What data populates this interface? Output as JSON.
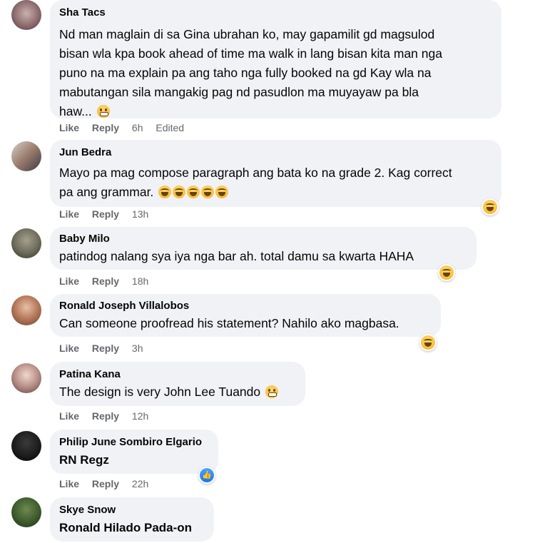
{
  "actions": {
    "like": "Like",
    "reply": "Reply",
    "edited": "Edited"
  },
  "colors": {
    "bubble": "#f0f2f5",
    "meta": "#65676b",
    "like_blue": "#1877f2",
    "emoji_yellow": "#f7b125"
  },
  "comments": [
    {
      "author": "Sha Tacs",
      "lines": [
        "Nd man maglain di sa Gina ubrahan ko, may gapamilit gd magsulod",
        "bisan wla kpa book ahead of time ma walk in lang bisan kita man nga",
        "puno na ma explain pa ang taho nga fully booked na gd Kay wla na",
        "mabutangan sila mangakig pag nd pasudlon ma muyayaw pa bla",
        "haw..."
      ],
      "inline_emoji": "grimace-emoji",
      "time": "6h"
    },
    {
      "author": "Jun Bedra",
      "lines": [
        "Mayo pa mag compose paragraph ang bata ko na grade 2. Kag correct",
        "pa ang grammar."
      ],
      "inline_emoji": "laughing-emoji x5",
      "reaction": "haha",
      "time": "13h"
    },
    {
      "author": "Baby Milo",
      "lines": [
        "patindog nalang sya iya nga bar ah. total damu sa kwarta HAHA"
      ],
      "reaction": "haha",
      "time": "18h"
    },
    {
      "author": "Ronald Joseph Villalobos",
      "lines": [
        "Can someone proofread his statement? Nahilo ako magbasa."
      ],
      "reaction": "haha",
      "time": "3h"
    },
    {
      "author": "Patina Kana",
      "lines": [
        "The design is very John Lee Tuando"
      ],
      "inline_emoji": "grimace-emoji",
      "time": "12h"
    },
    {
      "author": "Philip June Sombiro Elgario",
      "lines": [
        "RN Regz"
      ],
      "reaction": "like",
      "time": "22h"
    },
    {
      "author": "Skye Snow",
      "lines": [
        "Ronald Hilado Pada-on"
      ]
    }
  ]
}
